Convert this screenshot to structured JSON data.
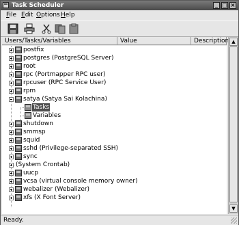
{
  "window": {
    "title": "Task Scheduler"
  },
  "menu": {
    "file": {
      "mnemonic": "F",
      "rest": "ile"
    },
    "edit": {
      "mnemonic": "E",
      "rest": "dit"
    },
    "options": {
      "mnemonic": "O",
      "rest": "ptions"
    },
    "help": {
      "mnemonic": "H",
      "rest": "elp"
    }
  },
  "toolbar": {
    "icons": [
      "floppy-save-icon",
      "printer-icon",
      "cut-scissors-icon",
      "copy-icon",
      "paste-icon"
    ]
  },
  "columns": {
    "users": "Users/Tasks/Variables",
    "value": "Value",
    "description": "Description"
  },
  "tree": {
    "rows": [
      {
        "label": "postfix"
      },
      {
        "label": "postgres (PostgreSQL Server)"
      },
      {
        "label": "root"
      },
      {
        "label": "rpc (Portmapper RPC user)"
      },
      {
        "label": "rpcuser (RPC Service User)"
      },
      {
        "label": "rpm"
      },
      {
        "label": "satya (Satya Sai Kolachina)"
      },
      {
        "label": "Tasks"
      },
      {
        "label": "Variables"
      },
      {
        "label": "shutdown"
      },
      {
        "label": "smmsp"
      },
      {
        "label": "squid"
      },
      {
        "label": "sshd (Privilege-separated SSH)"
      },
      {
        "label": "sync"
      },
      {
        "label": "(System Crontab)"
      },
      {
        "label": "uucp"
      },
      {
        "label": "vcsa (virtual console memory owner)"
      },
      {
        "label": "webalizer (Webalizer)"
      },
      {
        "label": "xfs (X Font Server)"
      }
    ]
  },
  "status": {
    "text": "Ready."
  },
  "colors": {
    "selection": "#4f4f4f",
    "titlebar": "#4a4a4a",
    "background": "#e6e6e6"
  }
}
